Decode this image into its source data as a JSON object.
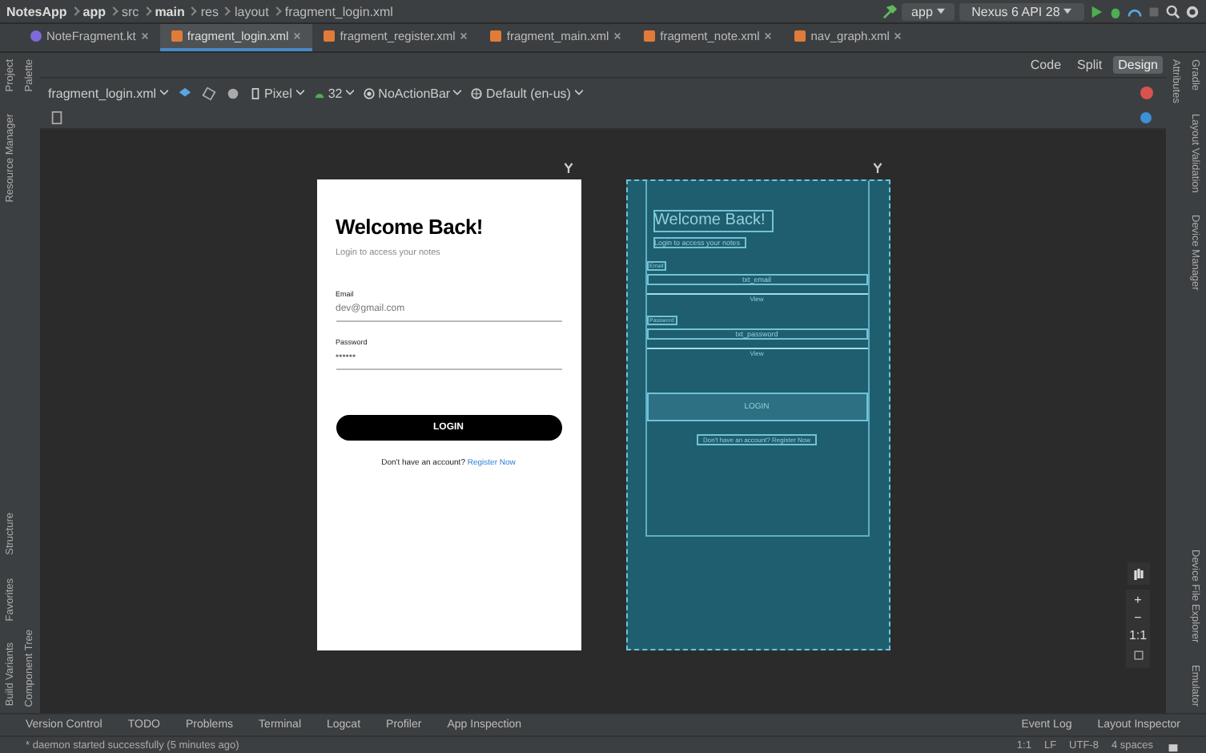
{
  "breadcrumb": [
    "NotesApp",
    "app",
    "src",
    "main",
    "res",
    "layout",
    "fragment_login.xml"
  ],
  "run_config": "app",
  "device": "Nexus 6 API 28",
  "tabs": [
    {
      "label": "NoteFragment.kt",
      "kind": "kotlin",
      "selected": false
    },
    {
      "label": "fragment_login.xml",
      "kind": "xml",
      "selected": true
    },
    {
      "label": "fragment_register.xml",
      "kind": "xml",
      "selected": false
    },
    {
      "label": "fragment_main.xml",
      "kind": "xml",
      "selected": false
    },
    {
      "label": "fragment_note.xml",
      "kind": "xml",
      "selected": false
    },
    {
      "label": "nav_graph.xml",
      "kind": "xml",
      "selected": false
    }
  ],
  "view_modes": [
    {
      "label": "Code",
      "selected": false
    },
    {
      "label": "Split",
      "selected": false
    },
    {
      "label": "Design",
      "selected": true
    }
  ],
  "design_toolbar": {
    "file": "fragment_login.xml",
    "device": "Pixel",
    "api": "32",
    "theme": "NoActionBar",
    "locale": "Default (en-us)"
  },
  "left_toolbar": {
    "top": [
      "Project",
      "Resource Manager"
    ],
    "bottom": [
      "Structure",
      "Favorites",
      "Build Variants"
    ]
  },
  "left_panel_toolbar": {
    "top": [
      "Palette"
    ],
    "bottom": [
      "Component Tree"
    ]
  },
  "right_panel_toolbar": {
    "top": [
      "Attributes"
    ]
  },
  "right_toolbar": {
    "top": [
      "Gradle",
      "Layout Validation",
      "Device Manager"
    ],
    "bottom": [
      "Device File Explorer",
      "Emulator"
    ]
  },
  "preview": {
    "title": "Welcome Back!",
    "subtitle": "Login to access your notes",
    "fields": [
      {
        "label": "Email",
        "value": "dev@gmail.com"
      },
      {
        "label": "Password",
        "value": "••••••"
      }
    ],
    "button": "LOGIN",
    "prompt": "Don't have an account?",
    "link": "Register Now"
  },
  "blueprint": {
    "title": "Welcome Back!",
    "subtitle": "Login to access your notes",
    "fields": [
      {
        "label": "Email",
        "id": "txt_email",
        "divider": "View"
      },
      {
        "label": "Password",
        "id": "txt_password",
        "divider": "View"
      }
    ],
    "button": "LOGIN",
    "prompt": "Don't have an account? Register Now"
  },
  "zoom_controls": [
    "+",
    "−",
    "1:1"
  ],
  "bottom_tools": [
    "Version Control",
    "TODO",
    "Problems",
    "Terminal",
    "Logcat",
    "Profiler",
    "App Inspection"
  ],
  "bottom_right_tools": [
    "Event Log",
    "Layout Inspector"
  ],
  "status": {
    "message": "* daemon started successfully (5 minutes ago)",
    "position": "1:1",
    "line_ending": "LF",
    "encoding": "UTF-8",
    "indent": "4 spaces"
  }
}
